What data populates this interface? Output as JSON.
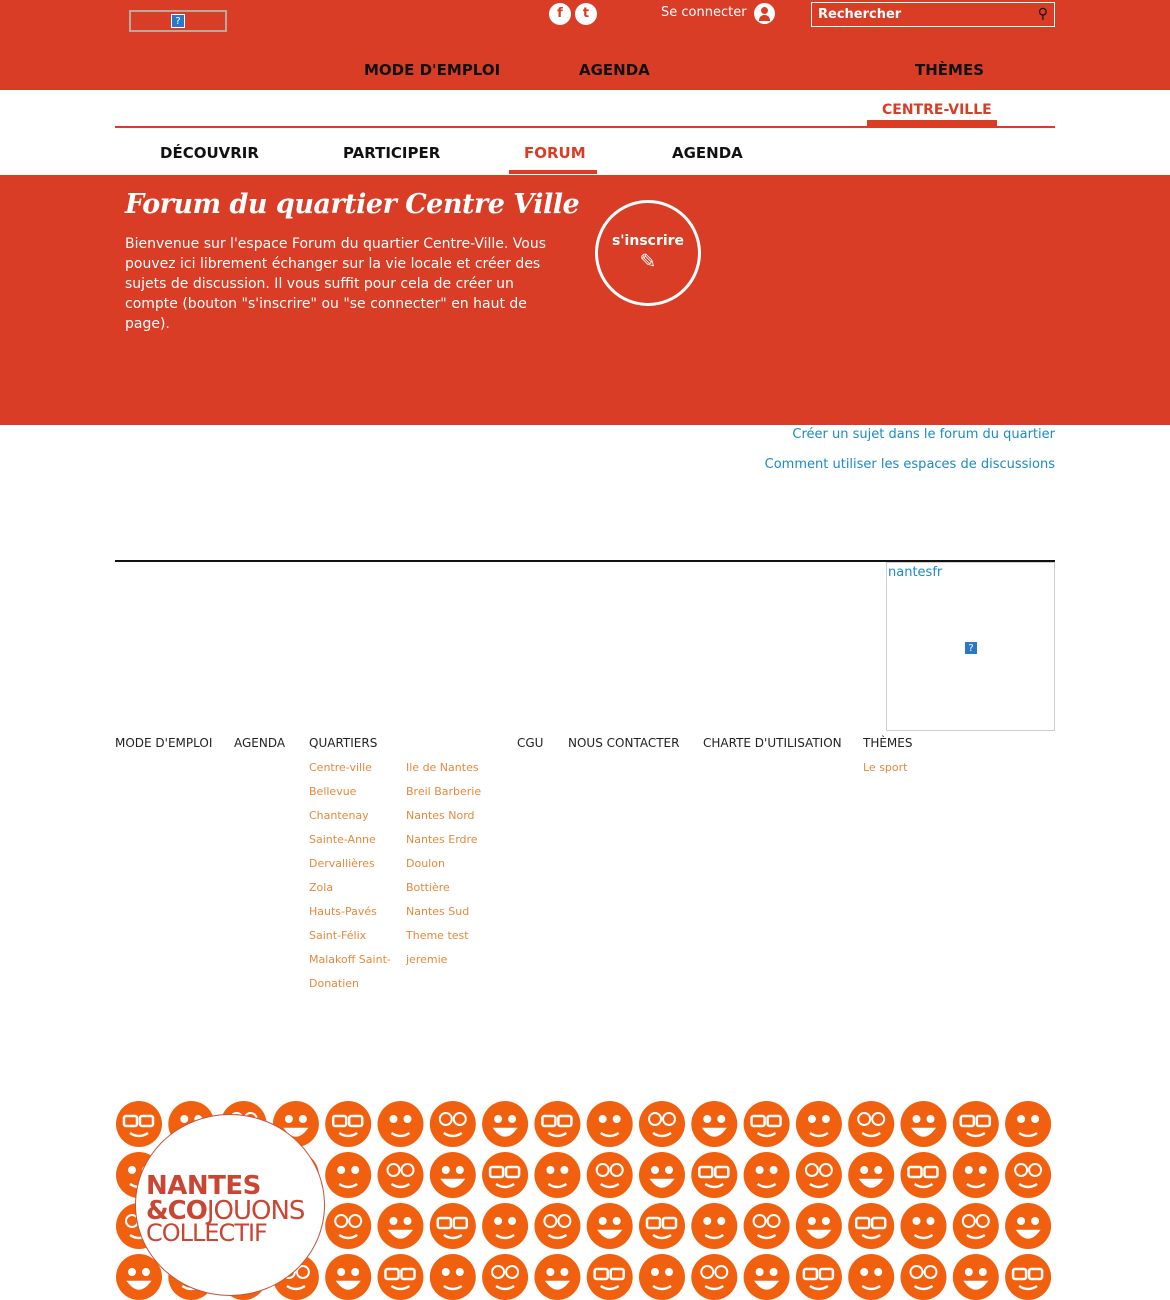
{
  "header": {
    "login": "Se connecter",
    "search_placeholder": "Rechercher",
    "social": [
      "facebook",
      "twitter"
    ],
    "nav": [
      "MODE D'EMPLOI",
      "AGENDA",
      "THÈMES"
    ]
  },
  "quartier": "CENTRE-VILLE",
  "subnav": [
    "DÉCOUVRIR",
    "PARTICIPER",
    "FORUM",
    "AGENDA"
  ],
  "hero": {
    "title": "Forum du quartier Centre Ville",
    "text": "Bienvenue sur l'espace Forum du quartier Centre-Ville. Vous pouvez ici librement échanger sur la vie locale et créer des sujets de discussion. Il vous suffit pour cela de créer un compte (bouton \"s'inscrire\" ou \"se connecter\" en haut de page).",
    "button": "s'inscrire"
  },
  "links": [
    "Créer un sujet dans le forum du quartier",
    "Comment utiliser les espaces de discussions"
  ],
  "widget": {
    "link": "nantesfr"
  },
  "footer": {
    "headers": [
      "MODE D'EMPLOI",
      "AGENDA",
      "QUARTIERS",
      "CGU",
      "NOUS CONTACTER",
      "CHARTE D'UTILISATION",
      "THÈMES"
    ],
    "quartiers_col1": [
      "Centre-ville",
      "Bellevue",
      "Chantenay",
      "Sainte-Anne",
      "Dervallières",
      "Zola",
      "Hauts-Pavés",
      "Saint-Félix",
      "Malakoff Saint-",
      "Donatien"
    ],
    "quartiers_col2": [
      "Ile de Nantes",
      "Breil Barberie",
      "Nantes Nord",
      "Nantes Erdre",
      "Doulon",
      "Bottière",
      "Nantes Sud",
      "Theme test",
      "jeremie"
    ],
    "themes": [
      "Le sport"
    ]
  },
  "banner": {
    "logo_line1": "NANTES",
    "logo_line2a": "&CO",
    "logo_line2b": "JOUONS",
    "logo_line3": "COLLECTIF"
  },
  "colors": {
    "brand": "#d93d26",
    "link": "#1a8ac8",
    "footer_link": "#e8883a",
    "smiley": "#f0600f"
  }
}
